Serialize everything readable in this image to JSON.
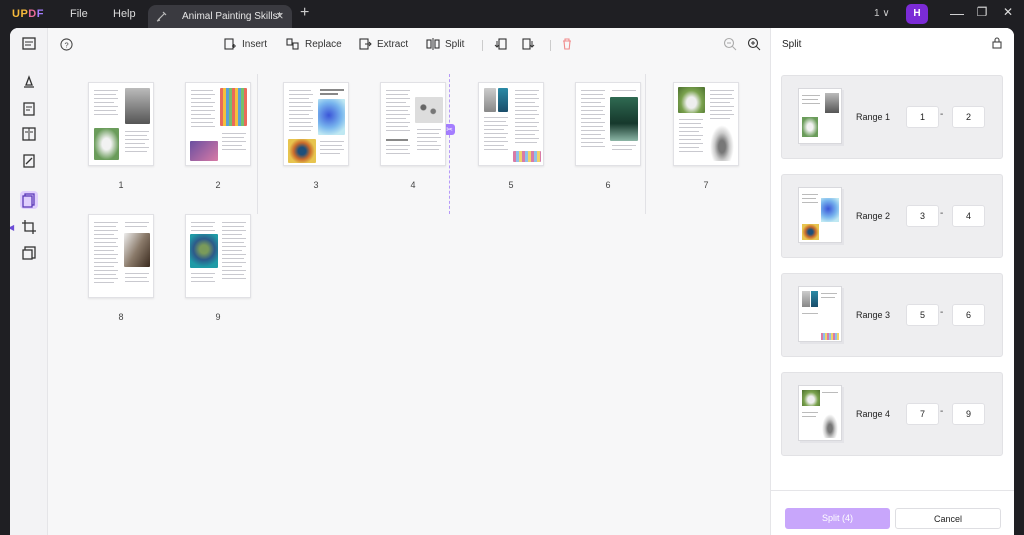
{
  "titlebar": {
    "logo": {
      "part1": "UP",
      "part2": "D",
      "part3": "F"
    },
    "menu": {
      "file": "File",
      "help": "Help"
    },
    "tab_title": "Animal Painting Skills*",
    "tab_close": "×",
    "new_tab": "+",
    "page_selector": "1 ∨",
    "avatar_initial": "H",
    "minimize": "—",
    "restore": "❐",
    "close": "✕"
  },
  "toolbar": {
    "insert": "Insert",
    "replace": "Replace",
    "extract": "Extract",
    "split": "Split"
  },
  "pages": [
    {
      "num": "1"
    },
    {
      "num": "2"
    },
    {
      "num": "3"
    },
    {
      "num": "4"
    },
    {
      "num": "5"
    },
    {
      "num": "6"
    },
    {
      "num": "7"
    },
    {
      "num": "8"
    },
    {
      "num": "9"
    }
  ],
  "panel": {
    "title": "Split",
    "ranges": [
      {
        "label": "Range 1",
        "from": "1",
        "to": "2"
      },
      {
        "label": "Range 2",
        "from": "3",
        "to": "4"
      },
      {
        "label": "Range 3",
        "from": "5",
        "to": "6"
      },
      {
        "label": "Range 4",
        "from": "7",
        "to": "9"
      }
    ],
    "range_dash": "-",
    "split_button": "Split (4)",
    "cancel_button": "Cancel"
  },
  "colors": {
    "accent": "#a47dff",
    "split_button": "#c8a6fb",
    "avatar": "#7b2bd6"
  }
}
